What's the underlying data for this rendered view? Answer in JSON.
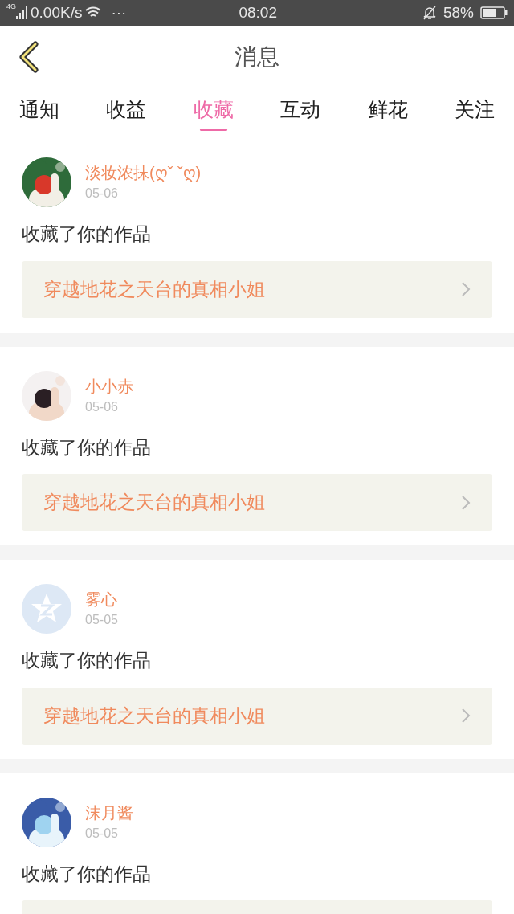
{
  "status_bar": {
    "network": "4G",
    "speed": "0.00K/s",
    "dots": "···",
    "time": "08:02",
    "battery": "58%"
  },
  "header": {
    "title": "消息"
  },
  "tabs": [
    {
      "label": "通知",
      "selected": false
    },
    {
      "label": "收益",
      "selected": false
    },
    {
      "label": "收藏",
      "selected": true
    },
    {
      "label": "互动",
      "selected": false
    },
    {
      "label": "鲜花",
      "selected": false
    },
    {
      "label": "关注",
      "selected": false
    }
  ],
  "messages": [
    {
      "name": "淡妆浓抹(ღˇ ˇღ)",
      "date": "05-06",
      "text": "收藏了你的作品",
      "work": "穿越地花之天台的真相小姐"
    },
    {
      "name": "小小赤",
      "date": "05-06",
      "text": "收藏了你的作品",
      "work": "穿越地花之天台的真相小姐"
    },
    {
      "avatar": {
        "kind": "icon"
      },
      "name": "雾心",
      "date": "05-05",
      "text": "收藏了你的作品",
      "work": "穿越地花之天台的真相小姐"
    },
    {
      "name": "沫月酱",
      "date": "05-05",
      "text": "收藏了你的作品"
    }
  ]
}
